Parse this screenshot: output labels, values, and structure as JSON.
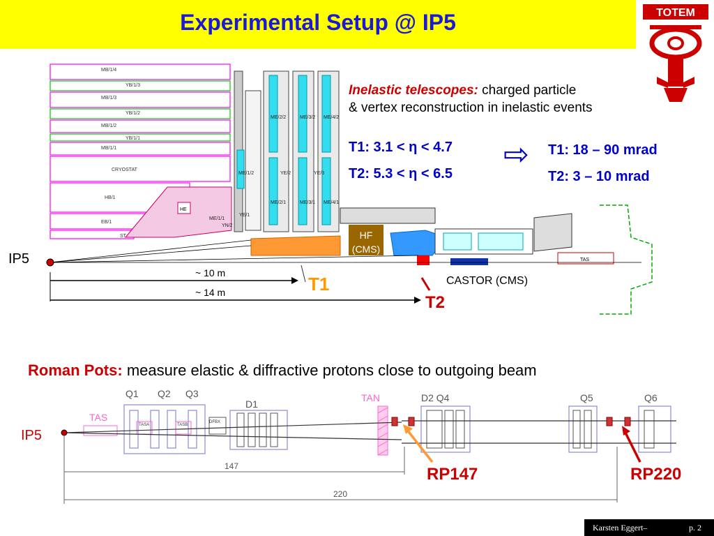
{
  "title": "Experimental Setup @ IP5",
  "logo": {
    "text": "TOTEM",
    "color": "#cc0000"
  },
  "top": {
    "inelastic_heading": "Inelastic telescopes:",
    "inelastic_line1": "charged particle",
    "inelastic_line2": "& vertex reconstruction in inelastic events",
    "t1_eta": "T1: 3.1 < η < 4.7",
    "t2_eta": "T2: 5.3 < η < 6.5",
    "arrow": "⇨",
    "t1_mrad": "T1: 18 – 90 mrad",
    "t2_mrad": "T2: 3 – 10 mrad",
    "ip5": "IP5",
    "dist_10": "~ 10 m",
    "dist_14": "~ 14 m",
    "t1_label": "T1",
    "t2_label": "T2",
    "hf_line1": "HF",
    "hf_line2": "(CMS)",
    "castor": "CASTOR (CMS)",
    "detector_labels": {
      "mb14": "MB/1/4",
      "yb13": "YB/1/3",
      "mb13": "MB/1/3",
      "yb12": "YB/1/2",
      "mb12": "MB/1/2",
      "yb11": "YB/1/1",
      "mb11": "MB/1/1",
      "cryostat": "CRYOSTAT",
      "hb1": "HB/1",
      "eb1": "EB/1",
      "he": "HE",
      "me11": "ME/1/1",
      "yn2": "YN/2",
      "ye1": "YE/1",
      "ye2": "YE/2",
      "ye3": "YE/3",
      "me12": "ME/1/2",
      "me21": "ME/2/1",
      "me22": "ME/2/2",
      "me31": "ME/3/1",
      "me32": "ME/3/2",
      "me41": "ME/4/1",
      "me42": "ME/4/2",
      "tas": "TAS",
      "st": "ST"
    }
  },
  "bottom": {
    "roman_pots_heading": "Roman Pots:",
    "roman_pots_text": "measure elastic & diffractive protons close to outgoing beam",
    "ip5": "IP5",
    "q1": "Q1",
    "q2": "Q2",
    "q3": "Q3",
    "d1": "D1",
    "tan": "TAN",
    "d2q4": "D2 Q4",
    "q5": "Q5",
    "q6": "Q6",
    "tas": "TAS",
    "tasa": "TASA",
    "tasb": "TASB",
    "dfbx": "DFBX",
    "dist_147": "147",
    "dist_220": "220",
    "rp147": "RP147",
    "rp220": "RP220"
  },
  "footer": {
    "author": "Karsten Eggert–",
    "page": "p. 2"
  },
  "colors": {
    "title": "#1a1ad6",
    "title_bg": "#ffff00",
    "highlight": "#cc0000",
    "annotation": "#0000cc",
    "hf": "#996600",
    "t1": "#ff9900"
  }
}
